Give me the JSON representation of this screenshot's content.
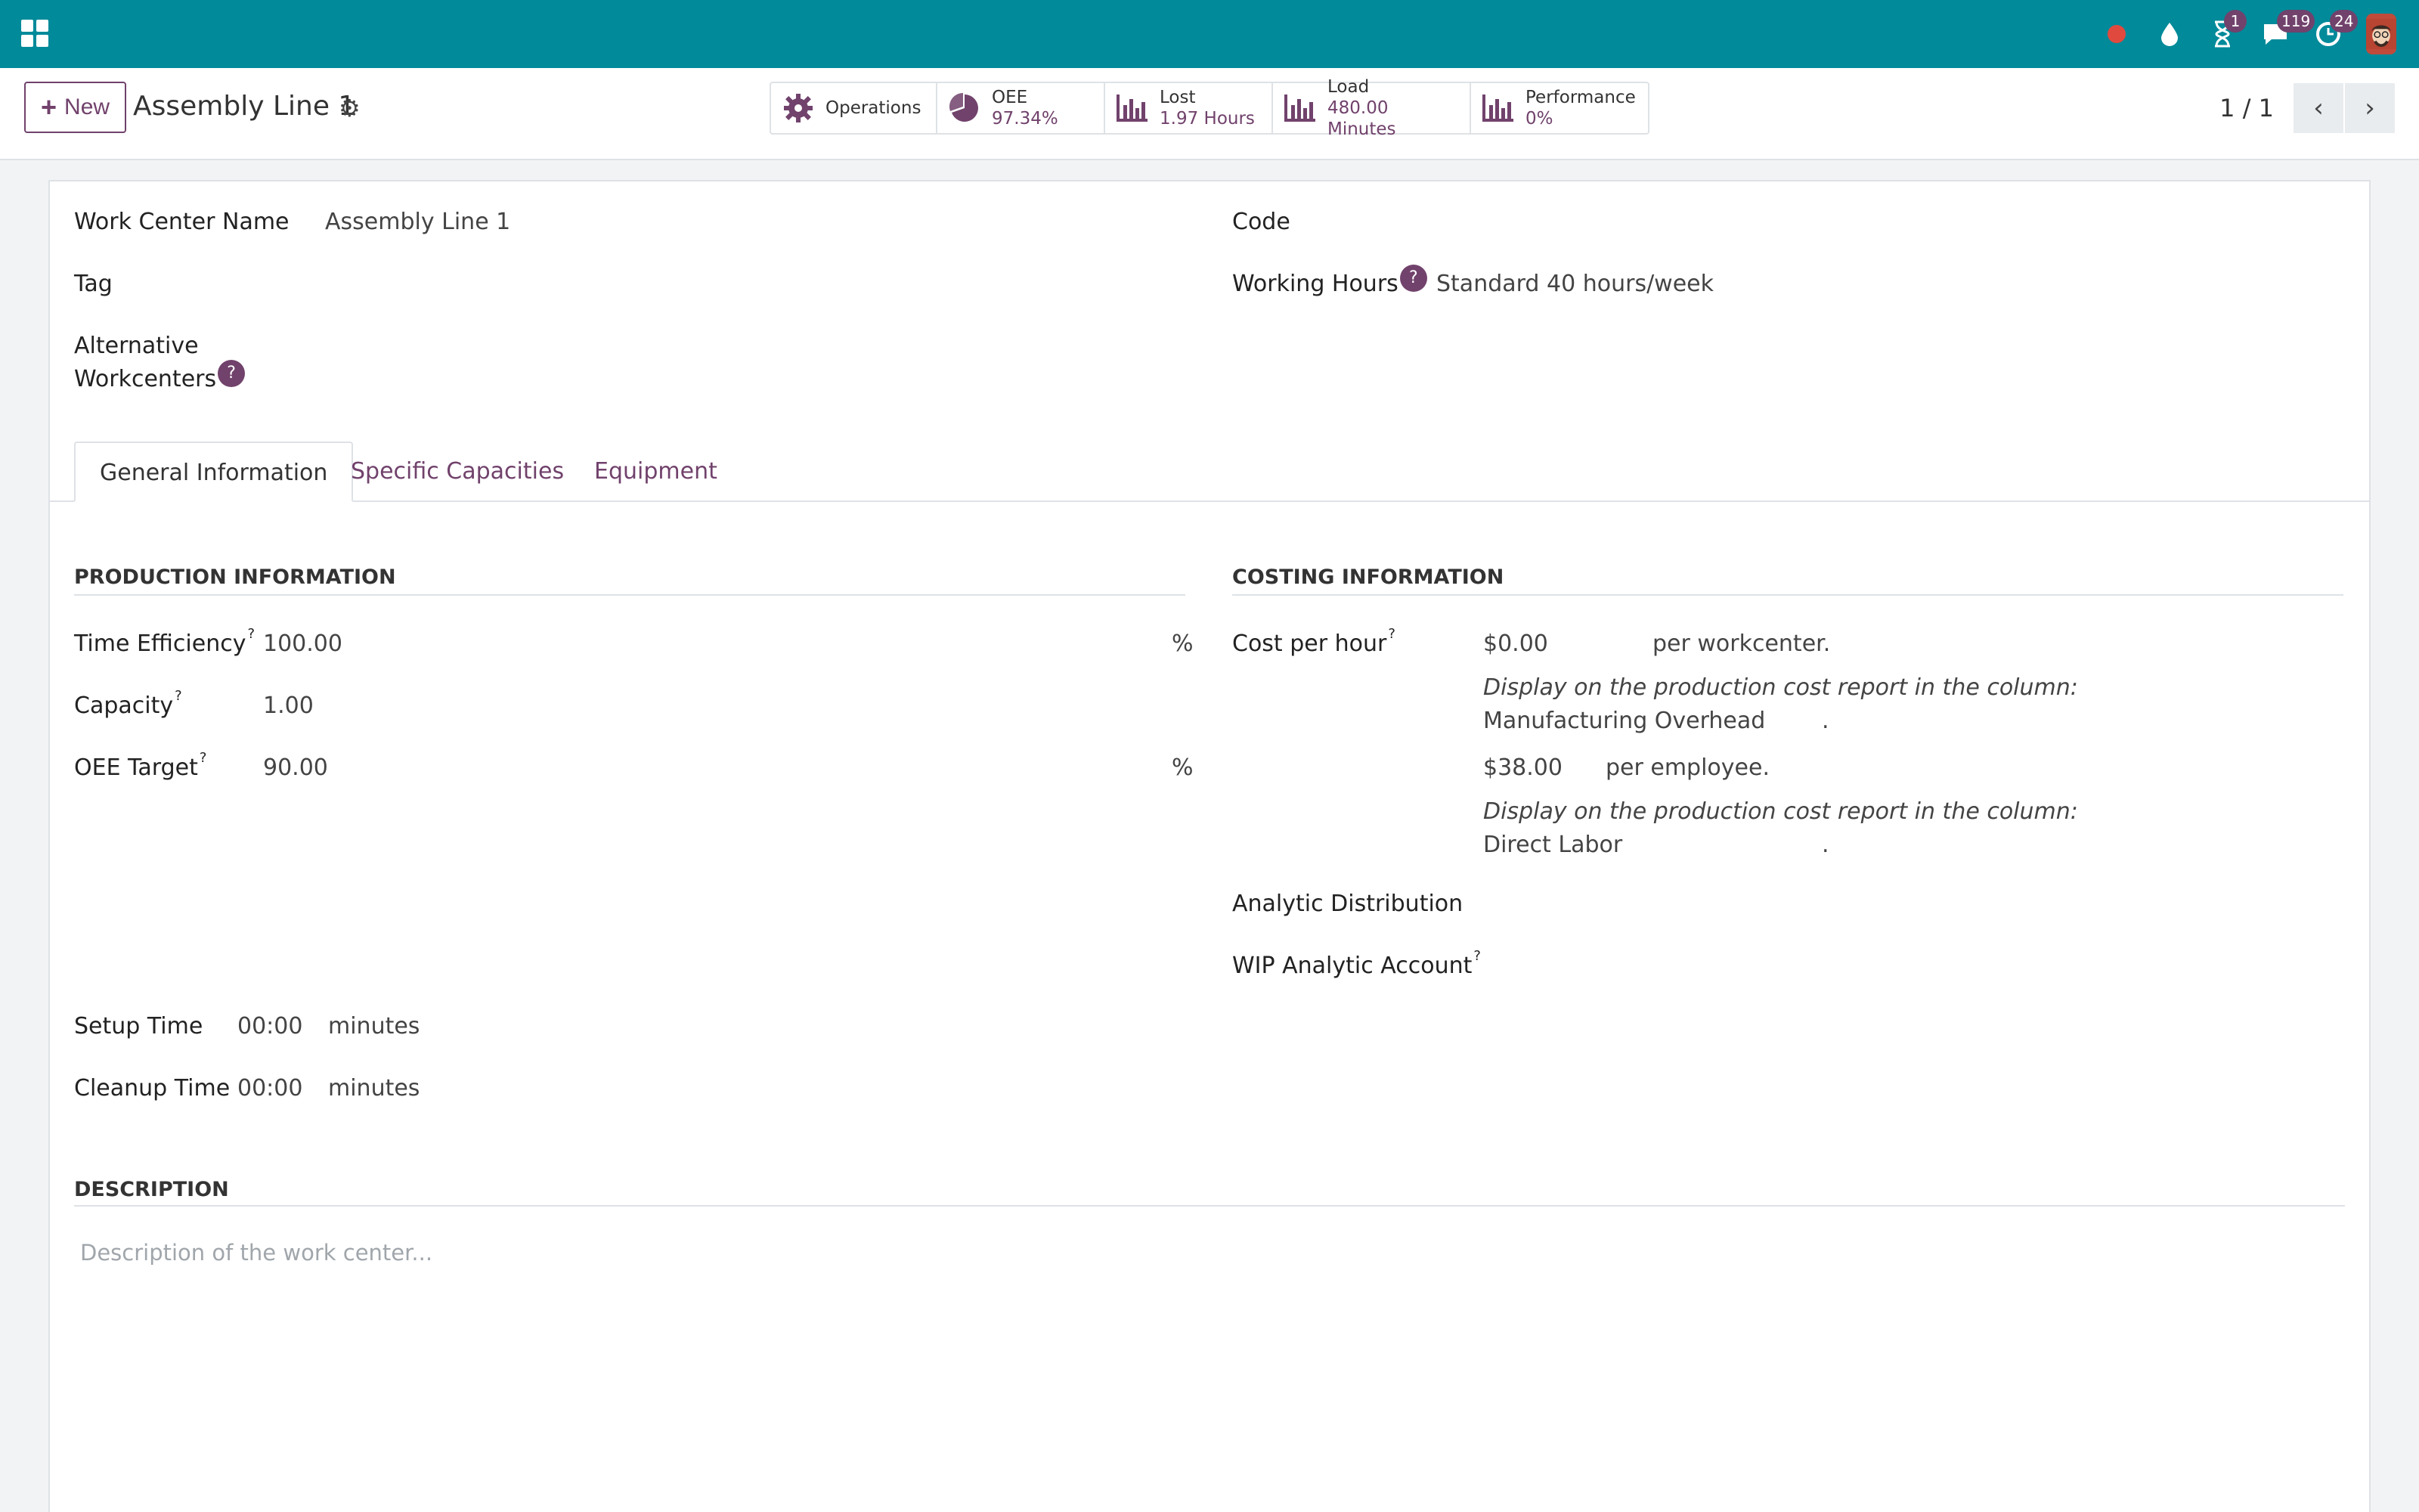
{
  "topbar": {
    "apps_icon": "apps-grid-icon",
    "systray": [
      {
        "icon": "recording-dot-icon"
      },
      {
        "icon": "drop-icon"
      },
      {
        "icon": "hourglass-icon",
        "badge": "1"
      },
      {
        "icon": "chat-icon",
        "badge": "119"
      },
      {
        "icon": "clock-icon",
        "badge": "24"
      },
      {
        "icon": "user-avatar"
      }
    ],
    "color": "#008a9a"
  },
  "control": {
    "new_label": "New",
    "title": "Assembly Line 1",
    "stats": [
      {
        "icon": "gear-icon",
        "label": "Operations",
        "value": ""
      },
      {
        "icon": "pie-chart-icon",
        "label": "OEE",
        "value": "97.34%"
      },
      {
        "icon": "bar-chart-icon",
        "label": "Lost",
        "value": "1.97 Hours"
      },
      {
        "icon": "bar-chart-icon",
        "label": "Load",
        "value": "480.00 Minutes"
      },
      {
        "icon": "bar-chart-icon",
        "label": "Performance",
        "value": "0%"
      }
    ],
    "pager": "1 / 1"
  },
  "form": {
    "work_center_name_label": "Work Center Name",
    "work_center_name_value": "Assembly Line 1",
    "tag_label": "Tag",
    "alt_label_1": "Alternative",
    "alt_label_2": "Workcenters",
    "code_label": "Code",
    "working_hours_label": "Working Hours",
    "working_hours_value": "Standard 40 hours/week",
    "help_mark": "?",
    "sup_mark": "?"
  },
  "tabs": [
    {
      "label": "General Information",
      "active": true
    },
    {
      "label": "Specific Capacities",
      "active": false
    },
    {
      "label": "Equipment",
      "active": false
    }
  ],
  "production": {
    "title": "PRODUCTION INFORMATION",
    "time_efficiency_label": "Time Efficiency",
    "time_efficiency_value": "100.00",
    "time_efficiency_unit": "%",
    "capacity_label": "Capacity",
    "capacity_value": "1.00",
    "oee_target_label": "OEE Target",
    "oee_target_value": "90.00",
    "oee_target_unit": "%",
    "setup_time_label": "Setup Time",
    "setup_time_value": "00:00",
    "setup_time_unit": "minutes",
    "cleanup_time_label": "Cleanup Time",
    "cleanup_time_value": "00:00",
    "cleanup_time_unit": "minutes"
  },
  "costing": {
    "title": "COSTING INFORMATION",
    "cost_per_hour_label": "Cost per hour",
    "cost_per_hour_value": "$0.00",
    "per_workcenter": "per workcenter.",
    "display_note": "Display on the production cost report in the column:",
    "column_overhead": "Manufacturing Overhead",
    "period": ".",
    "employee_cost_value": "$38.00",
    "per_employee": "per employee.",
    "column_labor": "Direct Labor",
    "analytic_label": "Analytic Distribution",
    "wip_label": "WIP Analytic Account"
  },
  "description": {
    "title": "DESCRIPTION",
    "placeholder": "Description of the work center..."
  },
  "colors": {
    "accent": "#71426c",
    "topbar": "#008a9a"
  }
}
